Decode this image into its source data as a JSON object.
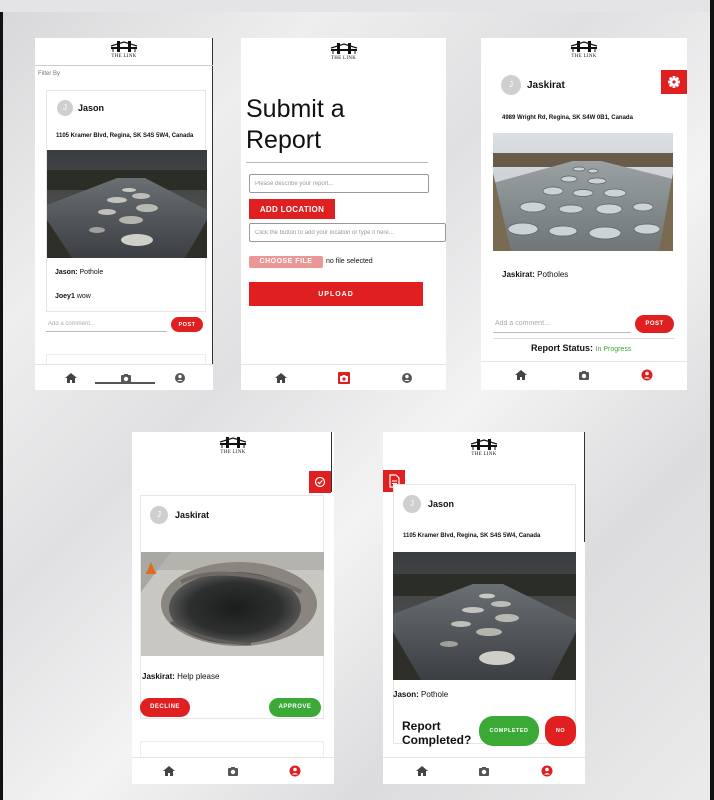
{
  "app": {
    "logo_text": "THE LINK"
  },
  "feed": {
    "filter_label": "Filter By",
    "post": {
      "user": "Jason",
      "avatar_initial": "J",
      "address": "1105 Kramer Blvd, Regina, SK S4S 5W4, Canada",
      "caption_user": "Jason:",
      "caption_text": "Pothole",
      "comment_user": "Joey1",
      "comment_text": "wow"
    },
    "comment_placeholder": "Add a comment...",
    "post_label": "POST"
  },
  "submit": {
    "title": "Submit a Report",
    "description_placeholder": "Please describe your report...",
    "add_location_label": "ADD LOCATION",
    "location_placeholder": "Click the button to add your location or type it here...",
    "choose_file_label": "CHOOSE FILE",
    "no_file_text": "no file selected",
    "upload_label": "UPLOAD"
  },
  "report_status": {
    "user": "Jaskirat",
    "avatar_initial": "J",
    "address": "4989 Wright Rd, Regina, SK S4W 0B1, Canada",
    "caption_user": "Jaskirat:",
    "caption_text": "Potholes",
    "comment_placeholder": "Add a comment...",
    "post_label": "POST",
    "status_label": "Report Status:",
    "status_value": "In Progress"
  },
  "approval": {
    "user": "Jaskirat",
    "avatar_initial": "J",
    "caption_user": "Jaskirat:",
    "caption_text": "Help please",
    "decline_label": "DECLINE",
    "approve_label": "APPROVE"
  },
  "completion": {
    "user": "Jason",
    "avatar_initial": "J",
    "address": "1105 Kramer Blvd, Regina, SK S4S 5W4, Canada",
    "caption_user": "Jason:",
    "caption_text": "Pothole",
    "question": "Report Completed?",
    "completed_label": "COMPLETED",
    "no_label": "NO"
  },
  "colors": {
    "accent_red": "#e02020",
    "accent_green": "#3aa935",
    "status_green": "#3aa935"
  },
  "icons": {
    "nav": [
      "home-icon",
      "camera-icon",
      "user-circle-icon"
    ],
    "report_status_action": "gear-icon",
    "approval_action": "check-circle-icon",
    "completion_action": "document-icon"
  }
}
